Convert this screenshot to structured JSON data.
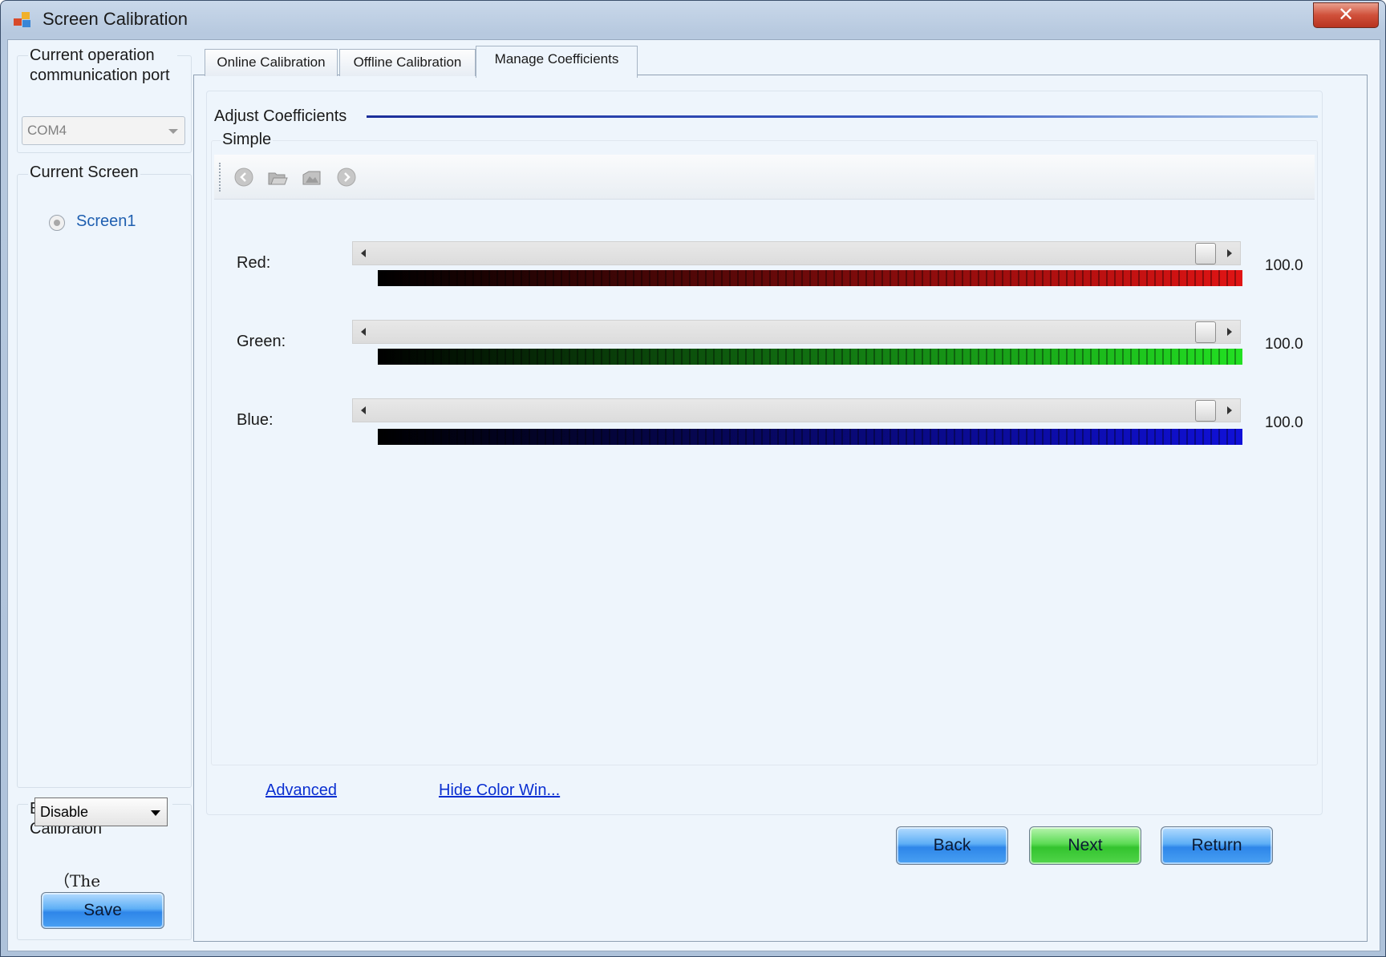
{
  "window": {
    "title": "Screen Calibration",
    "close_label": "✕"
  },
  "left": {
    "port_group_label": "Current operation communication port",
    "port_value": "COM4",
    "screen_group_label": "Current Screen",
    "screen_item": "Screen1",
    "enable_group_label": "Enable/Disnable Calibraion",
    "enable_value": "Disable",
    "note_text": "（The",
    "save_label": "Save"
  },
  "tabs": [
    {
      "label": "Online Calibration"
    },
    {
      "label": "Offline Calibration"
    },
    {
      "label": "Manage Coefficients"
    }
  ],
  "coefficients": {
    "section_label": "Adjust Coefficients",
    "mode_label": "Simple",
    "toolbar_icons": [
      "back-icon",
      "open-folder-icon",
      "open-file-icon",
      "forward-icon"
    ],
    "sliders": [
      {
        "label": "Red:",
        "value_text": "100.0",
        "level": 1.0,
        "color": "#e01414"
      },
      {
        "label": "Green:",
        "value_text": "100.0",
        "level": 1.0,
        "color": "#22e022"
      },
      {
        "label": "Blue:",
        "value_text": "100.0",
        "level": 1.0,
        "color": "#1010d8"
      }
    ],
    "advanced_link": "Advanced",
    "hide_color_link": "Hide Color Win..."
  },
  "buttons": {
    "back": "Back",
    "next": "Next",
    "return": "Return"
  }
}
